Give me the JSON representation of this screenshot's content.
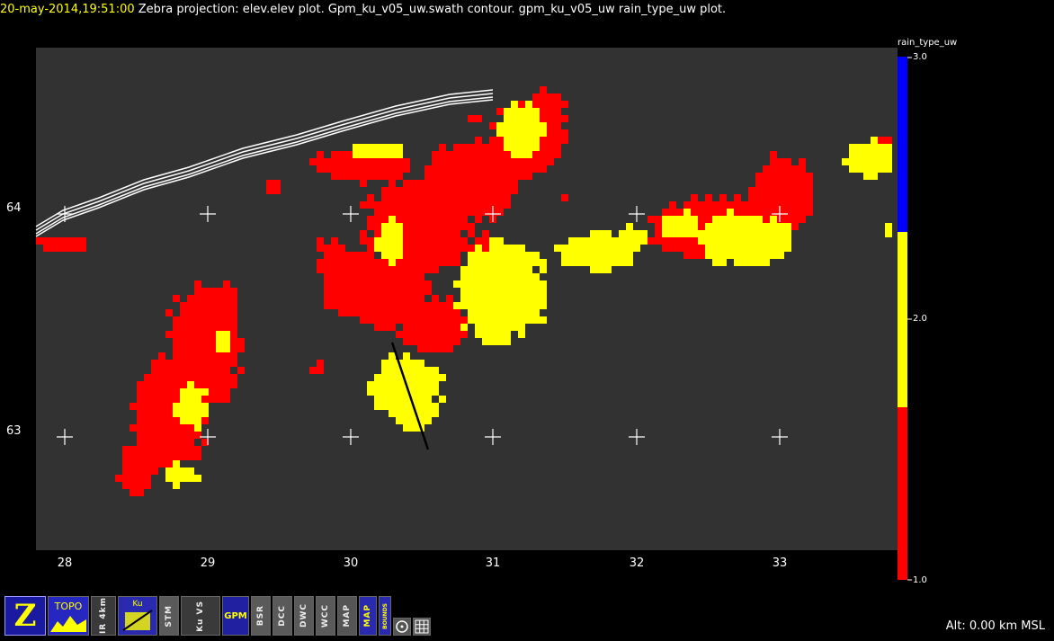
{
  "title": {
    "timestamp": "20-may-2014,19:51:00",
    "text": "Zebra projection: elev.elev  plot.  Gpm_ku_v05_uw.swath contour.  gpm_ku_v05_uw rain_type_uw  plot."
  },
  "axes": {
    "x_ticks": [
      "28",
      "29",
      "30",
      "31",
      "32",
      "33"
    ],
    "y_ticks": [
      "64",
      "63"
    ]
  },
  "legend": {
    "title": "rain_type_uw",
    "ticks": [
      "3.0",
      "2.0",
      "1.0"
    ],
    "colors": {
      "high": "#0000ff",
      "mid": "#ffff00",
      "low": "#ff0000"
    }
  },
  "status": {
    "altitude": "Alt: 0.00 km MSL"
  },
  "toolbar": {
    "z": "Z",
    "topo": "TOPO",
    "ir": "IR 4km",
    "ku": "Ku",
    "stm": "STM",
    "ku_vs": "Ku VS",
    "gpm": "GPM",
    "bsr": "BSR",
    "dcc": "DCC",
    "dwc": "DWC",
    "wcc": "WCC",
    "map1": "MAP",
    "map2": "MAP",
    "bounds": "BOUNDS"
  },
  "colors": {
    "background": "#000000",
    "plot_bg": "#323232",
    "convective": "#ff0000",
    "stratiform": "#ffff00",
    "swath": "#ffffff"
  }
}
